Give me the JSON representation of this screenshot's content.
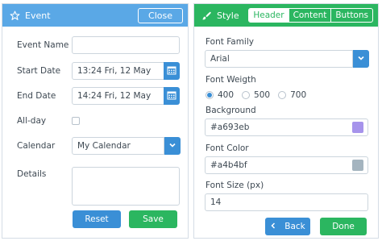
{
  "event": {
    "title": "Event",
    "close_label": "Close",
    "name_label": "Event Name",
    "name_value": "",
    "start_label": "Start Date",
    "start_value": "13:24 Fri, 12 May",
    "end_label": "End Date",
    "end_value": "14:24 Fri, 12 May",
    "allday_label": "All-day",
    "allday_checked": false,
    "calendar_label": "Calendar",
    "calendar_value": "My Calendar",
    "details_label": "Details",
    "details_value": "",
    "reset_label": "Reset",
    "save_label": "Save"
  },
  "style": {
    "title": "Style",
    "tabs": [
      {
        "label": "Header",
        "active": true
      },
      {
        "label": "Content",
        "active": false
      },
      {
        "label": "Buttons",
        "active": false
      }
    ],
    "font_family_label": "Font Family",
    "font_family_value": "Arial",
    "font_weight_label": "Font Weigth",
    "weights": [
      {
        "label": "400",
        "checked": true
      },
      {
        "label": "500",
        "checked": false
      },
      {
        "label": "700",
        "checked": false
      }
    ],
    "background_label": "Background",
    "background_value": "#a693eb",
    "font_color_label": "Font Color",
    "font_color_value": "#a4b4bf",
    "font_size_label": "Font Size (px)",
    "font_size_value": "14",
    "back_label": "Back",
    "done_label": "Done"
  },
  "colors": {
    "event_header": "#5aa8e6",
    "style_header": "#2bb660",
    "primary_button": "#3a8fd6",
    "success_button": "#2bb660"
  },
  "icons": {
    "event": "star-icon",
    "style": "paintbrush-icon",
    "date": "calendar-icon",
    "select": "chevron-down-icon",
    "back": "chevron-left-icon"
  }
}
